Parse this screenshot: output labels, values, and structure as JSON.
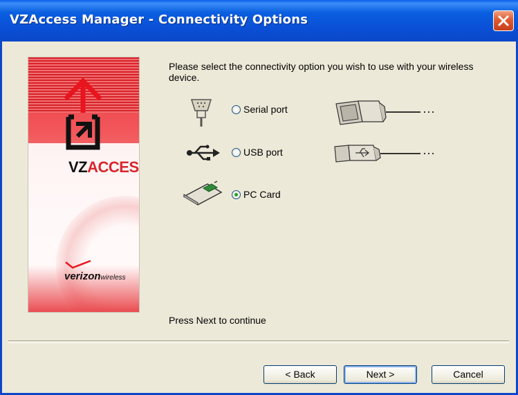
{
  "window": {
    "title": "VZAccess Manager - Connectivity Options",
    "close_label": "✕"
  },
  "banner": {
    "vz": "VZ",
    "access": "ACCESS",
    "tm": "™",
    "verizon": "verizon",
    "wireless": "wireless"
  },
  "main": {
    "prompt": "Please select the connectivity option you wish to use with your wireless device.",
    "options": [
      {
        "label": "Serial port",
        "checked": false,
        "icon": "serial-connector-icon"
      },
      {
        "label": "USB port",
        "checked": false,
        "icon": "usb-icon"
      },
      {
        "label": "PC Card",
        "checked": true,
        "icon": "pc-card-icon"
      }
    ],
    "footer_hint": "Press Next to continue"
  },
  "buttons": {
    "back": "< Back",
    "next": "Next >",
    "cancel": "Cancel"
  }
}
